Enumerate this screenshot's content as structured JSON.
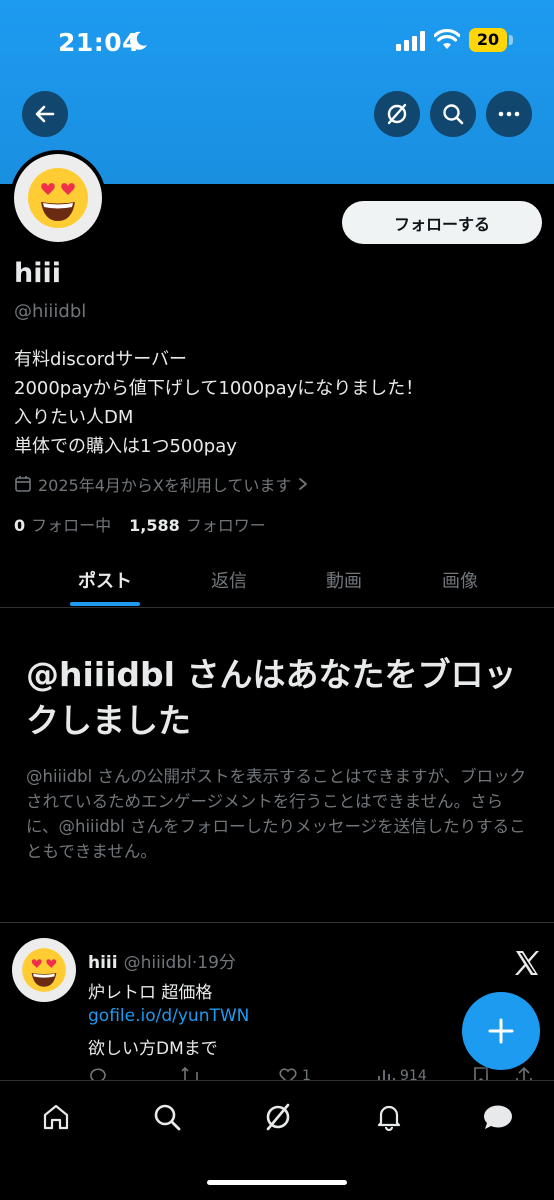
{
  "status_bar": {
    "time": "21:04",
    "battery": "20"
  },
  "profile": {
    "follow_label": "フォローする",
    "display_name": "hiii",
    "handle": "@hiiidbl",
    "bio": [
      "有料discordサーバー",
      "2000payから値下げして1000payになりました！",
      "入りたい人DM",
      "単体での購入は1つ500pay"
    ],
    "joined": "2025年4月からXを利用しています",
    "following_count": "0",
    "following_label": "フォロー中",
    "followers_count": "1,588",
    "followers_label": "フォロワー"
  },
  "tabs": [
    {
      "label": "ポスト",
      "active": true
    },
    {
      "label": "返信",
      "active": false
    },
    {
      "label": "動画",
      "active": false
    },
    {
      "label": "画像",
      "active": false
    }
  ],
  "blocked": {
    "title": "@hiiidbl さんはあなたをブロックしました",
    "description": "@hiiidbl さんの公開ポストを表示することはできますが、ブロックされているためエンゲージメントを行うことはできません。さらに、@hiiidbl さんをフォローしたりメッセージを送信したりすることもできません。"
  },
  "post": {
    "name": "hiii",
    "handle": "@hiiidbl",
    "time": "·19分",
    "line1": "炉レトロ 超価格",
    "link": "gofile.io/d/yunTWN",
    "line3": "欲しい方DMまで",
    "likes": "1",
    "views": "914"
  },
  "colors": {
    "accent": "#1d9bf0",
    "background": "#000000",
    "banner": "#1d9bf0"
  }
}
